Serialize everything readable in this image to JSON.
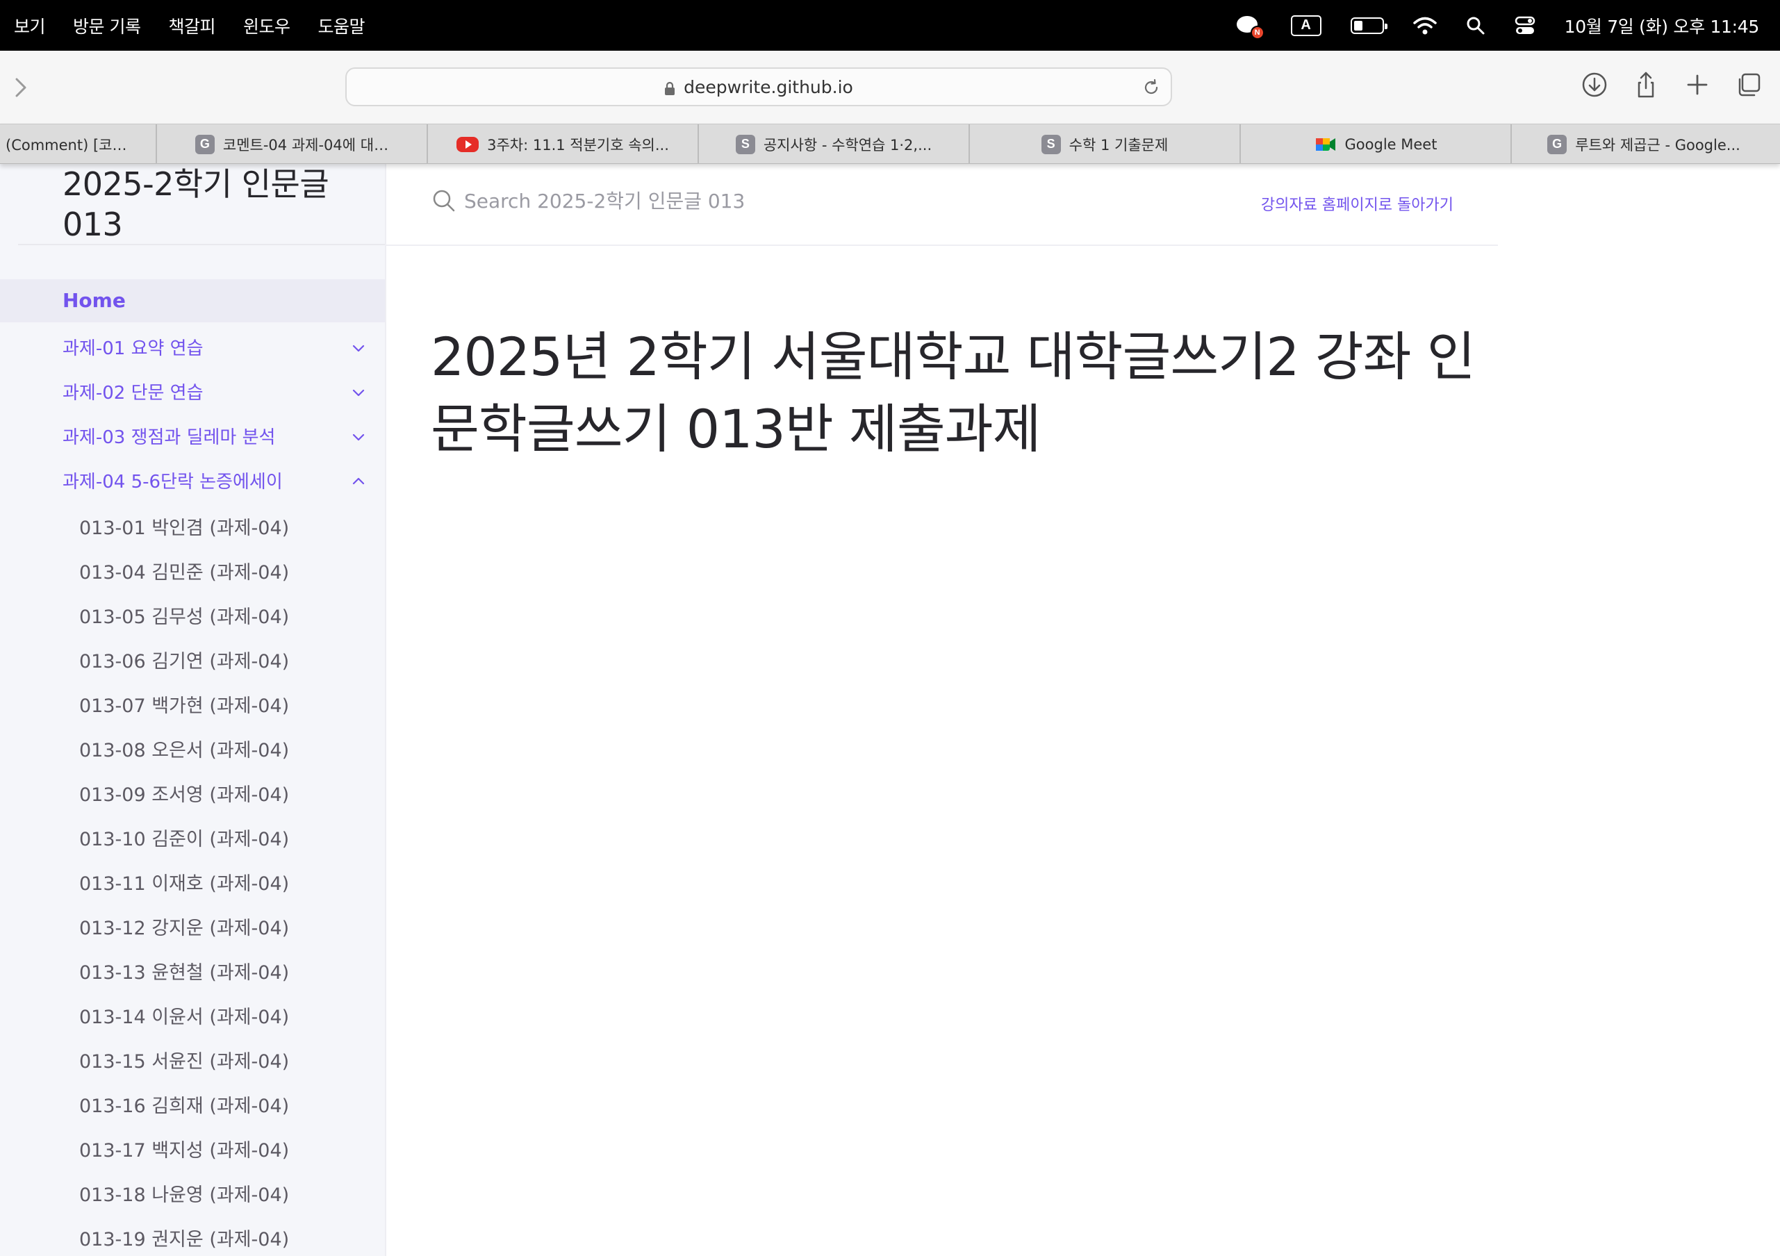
{
  "menubar": {
    "menus": [
      "보기",
      "방문 기록",
      "책갈피",
      "윈도우",
      "도움말"
    ],
    "chat_badge": "N",
    "input_source": "A",
    "battery_level": 0.3,
    "clock": "10월 7일 (화) 오후 11:45"
  },
  "toolbar": {
    "url": "deepwrite.github.io"
  },
  "tabs": [
    {
      "title": "(Comment) [코…",
      "icon": ""
    },
    {
      "title": "코멘트-04 과제-04에 대…",
      "icon": "G"
    },
    {
      "title": "3주차: 11.1 적분기호 속의...",
      "icon": "youtube"
    },
    {
      "title": "공지사항 - 수학연습 1·2,...",
      "icon": "S"
    },
    {
      "title": "수학 1 기출문제",
      "icon": "S"
    },
    {
      "title": "Google Meet",
      "icon": "meet"
    },
    {
      "title": "루트와 제곱근 - Google...",
      "icon": "G"
    }
  ],
  "sidebar": {
    "site_title": "2025-2학기 인문글 013",
    "home": "Home",
    "sections": [
      {
        "label": "과제-01 요약 연습",
        "expanded": false
      },
      {
        "label": "과제-02 단문 연습",
        "expanded": false
      },
      {
        "label": "과제-03 쟁점과 딜레마 분석",
        "expanded": false
      },
      {
        "label": "과제-04 5-6단락 논증에세이",
        "expanded": true
      }
    ],
    "sub_items": [
      "013-01 박인겸 (과제-04)",
      "013-04 김민준 (과제-04)",
      "013-05 김무성 (과제-04)",
      "013-06 김기연 (과제-04)",
      "013-07 백가현 (과제-04)",
      "013-08 오은서 (과제-04)",
      "013-09 조서영 (과제-04)",
      "013-10 김준이 (과제-04)",
      "013-11 이재호 (과제-04)",
      "013-12 강지운 (과제-04)",
      "013-13 윤현철 (과제-04)",
      "013-14 이윤서 (과제-04)",
      "013-15 서윤진 (과제-04)",
      "013-16 김희재 (과제-04)",
      "013-17 백지성 (과제-04)",
      "013-18 나윤영 (과제-04)",
      "013-19 권지운 (과제-04)"
    ]
  },
  "header": {
    "search_placeholder": "Search 2025-2학기 인문글 013",
    "aux_link": "강의자료 홈페이지로 돌아가기"
  },
  "main": {
    "title": "2025년 2학기 서울대학교 대학글쓰기2 강좌 인문학글쓰기 013반 제출과제"
  },
  "colors": {
    "accent": "#7253ed",
    "sidebar_bg": "#f5f6fa",
    "text": "#27262b"
  }
}
